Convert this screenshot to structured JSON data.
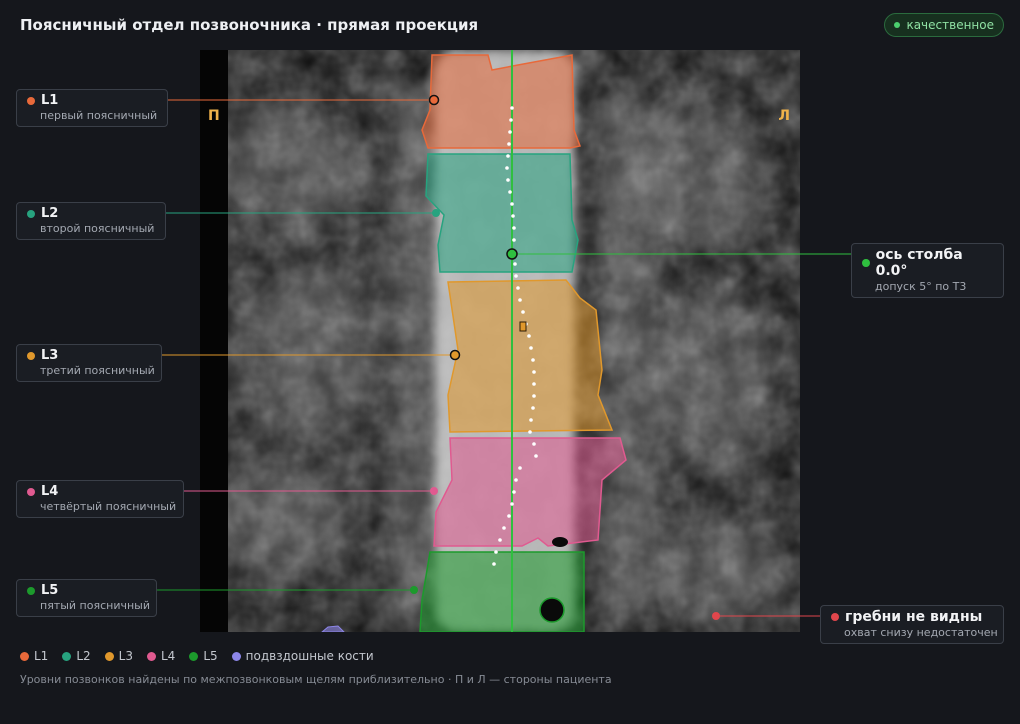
{
  "header": {
    "title": "Поясничный отдел позвоночника · прямая проекция",
    "badge": "качественное"
  },
  "image": {
    "side_left": "П",
    "side_right": "Л"
  },
  "callouts": [
    {
      "label": "L1",
      "sub": "первый поясничный",
      "color": "#e8693a"
    },
    {
      "label": "L2",
      "sub": "второй поясничный",
      "color": "#27a37f"
    },
    {
      "label": "L3",
      "sub": "третий поясничный",
      "color": "#e0982c"
    },
    {
      "label": "L4",
      "sub": "четвёртый поясничный",
      "color": "#e05a90"
    },
    {
      "label": "L5",
      "sub": "пятый поясничный",
      "color": "#1c9a2c"
    },
    {
      "label": "ось столба 0.0°",
      "sub": "допуск 5° по Т3",
      "color": "#2fbf3f"
    },
    {
      "label": "гребни не видны",
      "sub": "охват снизу недостаточен",
      "color": "#e0464c"
    }
  ],
  "legend": [
    {
      "label": "L1",
      "color": "#e8693a"
    },
    {
      "label": "L2",
      "color": "#27a37f"
    },
    {
      "label": "L3",
      "color": "#e0982c"
    },
    {
      "label": "L4",
      "color": "#e05a90"
    },
    {
      "label": "L5",
      "color": "#1c9a2c"
    },
    {
      "label": "подвздошные кости",
      "color": "#8d86e8"
    }
  ],
  "footnote": "Уровни позвонков найдены по межпозвонковым щелям приблизительно · П и Л — стороны пациента"
}
